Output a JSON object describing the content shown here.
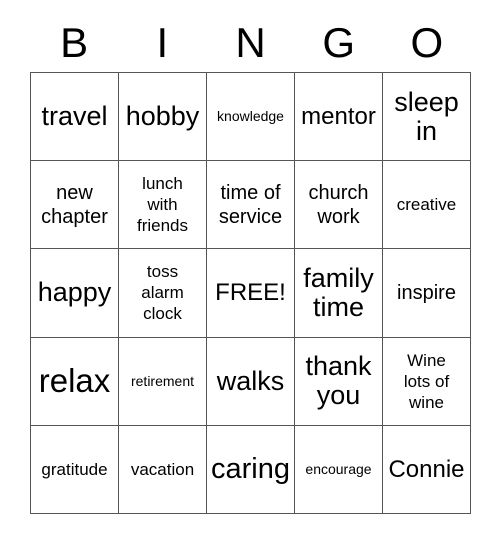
{
  "card": {
    "title": "BINGO",
    "header_letters": [
      "B",
      "I",
      "N",
      "G",
      "O"
    ],
    "free_space_label": "FREE!",
    "grid_size": "5x5",
    "colors": {
      "background": "#ffffff",
      "text": "#000000",
      "grid_line": "#555555"
    },
    "cells": [
      [
        {
          "text": "travel",
          "size": "lg"
        },
        {
          "text": "hobby",
          "size": "lg"
        },
        {
          "text": "knowledge",
          "size": "xxs"
        },
        {
          "text": "mentor",
          "size": "md"
        },
        {
          "text": "sleep\nin",
          "size": "lg"
        }
      ],
      [
        {
          "text": "new\nchapter",
          "size": "sm"
        },
        {
          "text": "lunch\nwith\nfriends",
          "size": "xs"
        },
        {
          "text": "time of\nservice",
          "size": "sm"
        },
        {
          "text": "church\nwork",
          "size": "sm"
        },
        {
          "text": "creative",
          "size": "xs"
        }
      ],
      [
        {
          "text": "happy",
          "size": "lg"
        },
        {
          "text": "toss\nalarm\nclock",
          "size": "xs"
        },
        {
          "text": "FREE!",
          "size": "md"
        },
        {
          "text": "family\ntime",
          "size": "lg"
        },
        {
          "text": "inspire",
          "size": "sm"
        }
      ],
      [
        {
          "text": "relax",
          "size": "xxl"
        },
        {
          "text": "retirement",
          "size": "xxs"
        },
        {
          "text": "walks",
          "size": "lg"
        },
        {
          "text": "thank\nyou",
          "size": "lg"
        },
        {
          "text": "Wine\nlots of\nwine",
          "size": "xs"
        }
      ],
      [
        {
          "text": "gratitude",
          "size": "xs"
        },
        {
          "text": "vacation",
          "size": "xs"
        },
        {
          "text": "caring",
          "size": "xl"
        },
        {
          "text": "encourage",
          "size": "xxs"
        },
        {
          "text": "Connie",
          "size": "md"
        }
      ]
    ]
  }
}
